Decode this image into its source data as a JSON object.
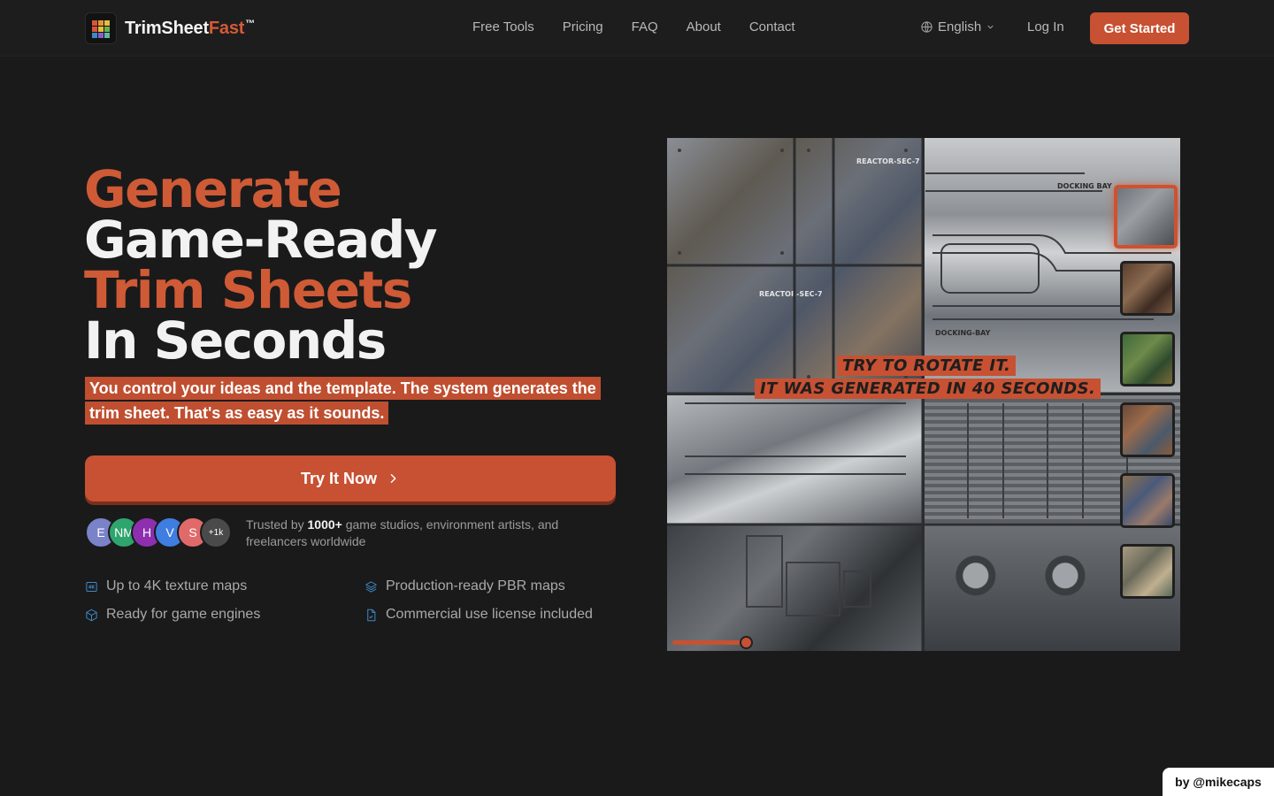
{
  "brand": {
    "name_part1": "TrimSheet",
    "name_part2": "Fast",
    "trademark": "™",
    "logo_colors": [
      "#d8553a",
      "#e59435",
      "#e6bd40",
      "#6ab04c",
      "#3f88c5",
      "#8b5cc9",
      "#5fb7a3",
      "#d8553a",
      "#a8a8a8"
    ]
  },
  "nav": {
    "links": [
      "Free Tools",
      "Pricing",
      "FAQ",
      "About",
      "Contact"
    ],
    "language": "English",
    "login": "Log In",
    "cta": "Get Started"
  },
  "hero": {
    "line1": "Generate",
    "line2": "Game-Ready",
    "line3": "Trim Sheets",
    "line4": "In Seconds",
    "subcopy": "You control your ideas and the template. The system generates the trim sheet. That's as easy as it sounds.",
    "cta": "Try It Now",
    "avatars": [
      {
        "initial": "E",
        "color": "#7a82c8"
      },
      {
        "initial": "NM",
        "color": "#2fa56e"
      },
      {
        "initial": "H",
        "color": "#8e2fb0"
      },
      {
        "initial": "V",
        "color": "#3f7ee0"
      },
      {
        "initial": "S",
        "color": "#e06a6a"
      },
      {
        "initial": "+1k",
        "color": "#4a4a4a"
      }
    ],
    "trusted_prefix": "Trusted by",
    "trusted_count": "1000+",
    "trusted_suffix": "game studios, environment artists, and freelancers worldwide",
    "features": [
      {
        "icon": "4k-icon",
        "text": "Up to 4K texture maps"
      },
      {
        "icon": "layers-icon",
        "text": "Production-ready PBR maps"
      },
      {
        "icon": "cube-icon",
        "text": "Ready for game engines"
      },
      {
        "icon": "document-icon",
        "text": "Commercial use license included"
      }
    ],
    "accent_color": "#c75132"
  },
  "preview": {
    "overlay_line1": "TRY TO ROTATE IT.",
    "overlay_line2": "IT WAS GENERATED IN 40 SECONDS.",
    "tile_labels": [
      "REACTOR-SEC-7",
      "REACTOR-SEC-7",
      "DOCKING BAY",
      "DOCKING-BAY"
    ]
  },
  "footer": {
    "credit": "by @mikecaps"
  }
}
